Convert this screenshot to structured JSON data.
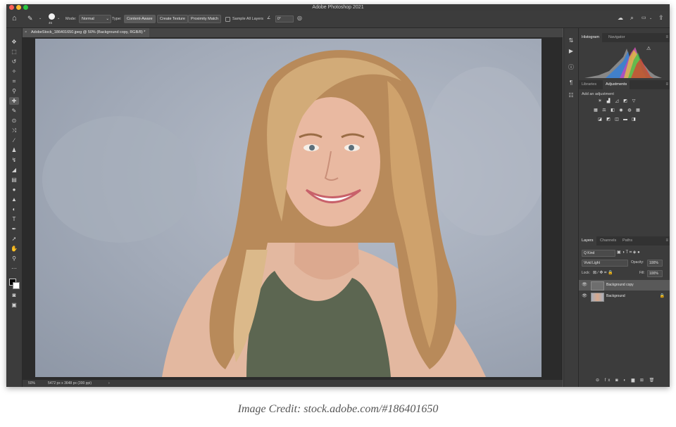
{
  "window": {
    "title": "Adobe Photoshop 2021"
  },
  "options_bar": {
    "brush_size": "45",
    "mode_label": "Mode:",
    "mode_value": "Normal",
    "type_label": "Type:",
    "type_options": [
      "Content-Aware",
      "Create Texture",
      "Proximity Match"
    ],
    "sample_all_layers": "Sample All Layers",
    "angle_value": "0°"
  },
  "document": {
    "tab_title": "AdobeStock_186401650.jpeg @ 50% (Background copy, RGB/8) *",
    "close_glyph": "×"
  },
  "status_bar": {
    "zoom": "50%",
    "info": "5472 px x 3648 px (300 ppi)",
    "arrow": "›"
  },
  "panels": {
    "histogram": {
      "tabs": [
        "Histogram",
        "Navigator"
      ],
      "warning": "⚠"
    },
    "adjustments": {
      "tabs": [
        "Libraries",
        "Adjustments"
      ],
      "add_label": "Add an adjustment"
    },
    "layers": {
      "tabs": [
        "Layers",
        "Channels",
        "Paths"
      ],
      "kind_label": "Q Kind",
      "blend_mode": "Vivid Light",
      "opacity_label": "Opacity:",
      "opacity_value": "100%",
      "lock_label": "Lock:",
      "fill_label": "Fill:",
      "fill_value": "100%",
      "layers": [
        {
          "name": "Background copy",
          "selected": true
        },
        {
          "name": "Background",
          "selected": false
        }
      ]
    }
  },
  "caption": "Image Credit: stock.adobe.com/#186401650",
  "colors": {
    "accent": "#3c3c3c",
    "canvas_bg": "#2b2b2b"
  }
}
